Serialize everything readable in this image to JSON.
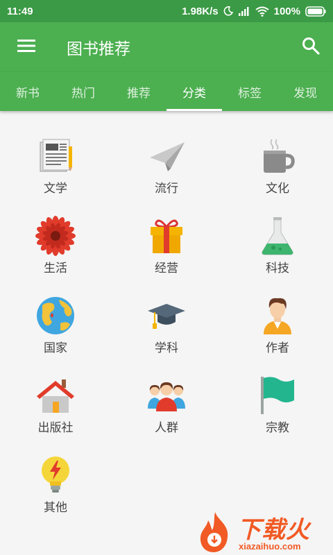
{
  "status_bar": {
    "time": "11:49",
    "net_speed": "1.98K/s",
    "battery": "100%"
  },
  "app_bar": {
    "title": "图书推荐",
    "menu_icon": "menu-icon",
    "search_icon": "search-icon"
  },
  "tabs": [
    {
      "label": "新书",
      "active": false
    },
    {
      "label": "热门",
      "active": false
    },
    {
      "label": "推荐",
      "active": false
    },
    {
      "label": "分类",
      "active": true
    },
    {
      "label": "标签",
      "active": false
    },
    {
      "label": "发现",
      "active": false
    }
  ],
  "categories": [
    {
      "label": "文学",
      "icon": "newspaper-icon"
    },
    {
      "label": "流行",
      "icon": "paper-plane-icon"
    },
    {
      "label": "文化",
      "icon": "coffee-cup-icon"
    },
    {
      "label": "生活",
      "icon": "flower-icon"
    },
    {
      "label": "经营",
      "icon": "gift-box-icon"
    },
    {
      "label": "科技",
      "icon": "flask-icon"
    },
    {
      "label": "国家",
      "icon": "globe-icon"
    },
    {
      "label": "学科",
      "icon": "graduation-cap-icon"
    },
    {
      "label": "作者",
      "icon": "person-icon"
    },
    {
      "label": "出版社",
      "icon": "house-icon"
    },
    {
      "label": "人群",
      "icon": "people-group-icon"
    },
    {
      "label": "宗教",
      "icon": "flag-icon"
    },
    {
      "label": "其他",
      "icon": "lightbulb-icon"
    }
  ],
  "watermark": {
    "text": "下载火",
    "sub": "xiazaihuo.com"
  },
  "colors": {
    "primary": "#4caf50",
    "status_bar": "#3a9a45",
    "background": "#f5f5f5"
  }
}
